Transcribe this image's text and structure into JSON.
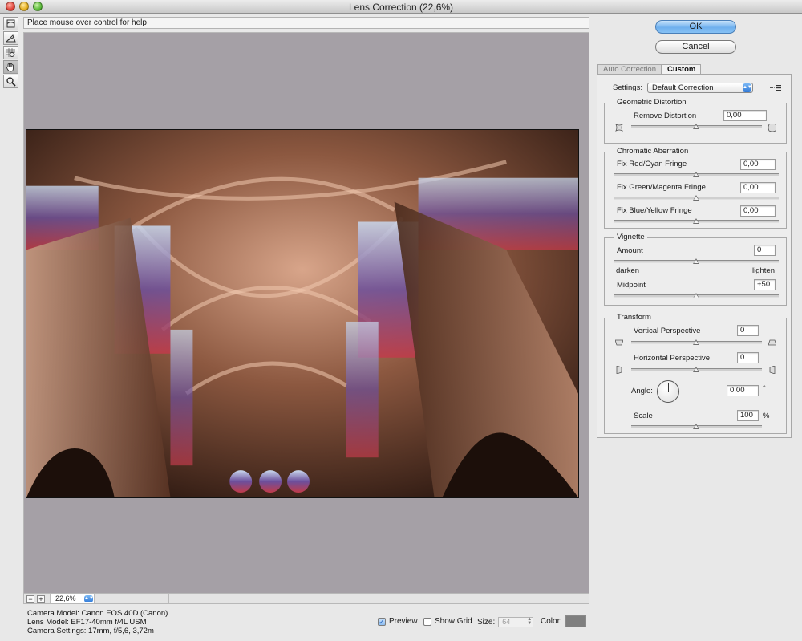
{
  "window": {
    "title": "Lens Correction (22,6%)"
  },
  "help": {
    "text": "Place mouse over control for help"
  },
  "tools": [
    {
      "name": "remove-distortion-tool-icon"
    },
    {
      "name": "straighten-tool-icon"
    },
    {
      "name": "move-grid-tool-icon"
    },
    {
      "name": "hand-tool-icon"
    },
    {
      "name": "zoom-tool-icon"
    }
  ],
  "buttons": {
    "ok": "OK",
    "cancel": "Cancel"
  },
  "tabs": {
    "auto": "Auto Correction",
    "custom": "Custom"
  },
  "settings": {
    "label": "Settings:",
    "value": "Default Correction"
  },
  "geometric": {
    "title": "Geometric Distortion",
    "remove_label": "Remove Distortion",
    "remove_value": "0,00"
  },
  "chromatic": {
    "title": "Chromatic Aberration",
    "red_label": "Fix Red/Cyan Fringe",
    "red_value": "0,00",
    "green_label": "Fix Green/Magenta Fringe",
    "green_value": "0,00",
    "blue_label": "Fix Blue/Yellow Fringe",
    "blue_value": "0,00"
  },
  "vignette": {
    "title": "Vignette",
    "amount_label": "Amount",
    "amount_value": "0",
    "darken": "darken",
    "lighten": "lighten",
    "midpoint_label": "Midpoint",
    "midpoint_value": "+50"
  },
  "transform": {
    "title": "Transform",
    "vertical_label": "Vertical Perspective",
    "vertical_value": "0",
    "horizontal_label": "Horizontal Perspective",
    "horizontal_value": "0",
    "angle_label": "Angle:",
    "angle_value": "0,00",
    "angle_unit": "°",
    "scale_label": "Scale",
    "scale_value": "100",
    "scale_unit": "%"
  },
  "zoom": {
    "value": "22,6%",
    "minus": "−",
    "plus": "+"
  },
  "camera": {
    "model": "Camera Model: Canon EOS 40D (Canon)",
    "lens": "Lens Model: EF17-40mm f/4L USM",
    "settings": "Camera Settings: 17mm, f/5,6, 3,72m"
  },
  "options": {
    "preview_label": "Preview",
    "preview_checked": true,
    "grid_label": "Show Grid",
    "grid_checked": false,
    "size_label": "Size:",
    "size_value": "64",
    "color_label": "Color:",
    "grid_color": "#7f7f7f"
  }
}
